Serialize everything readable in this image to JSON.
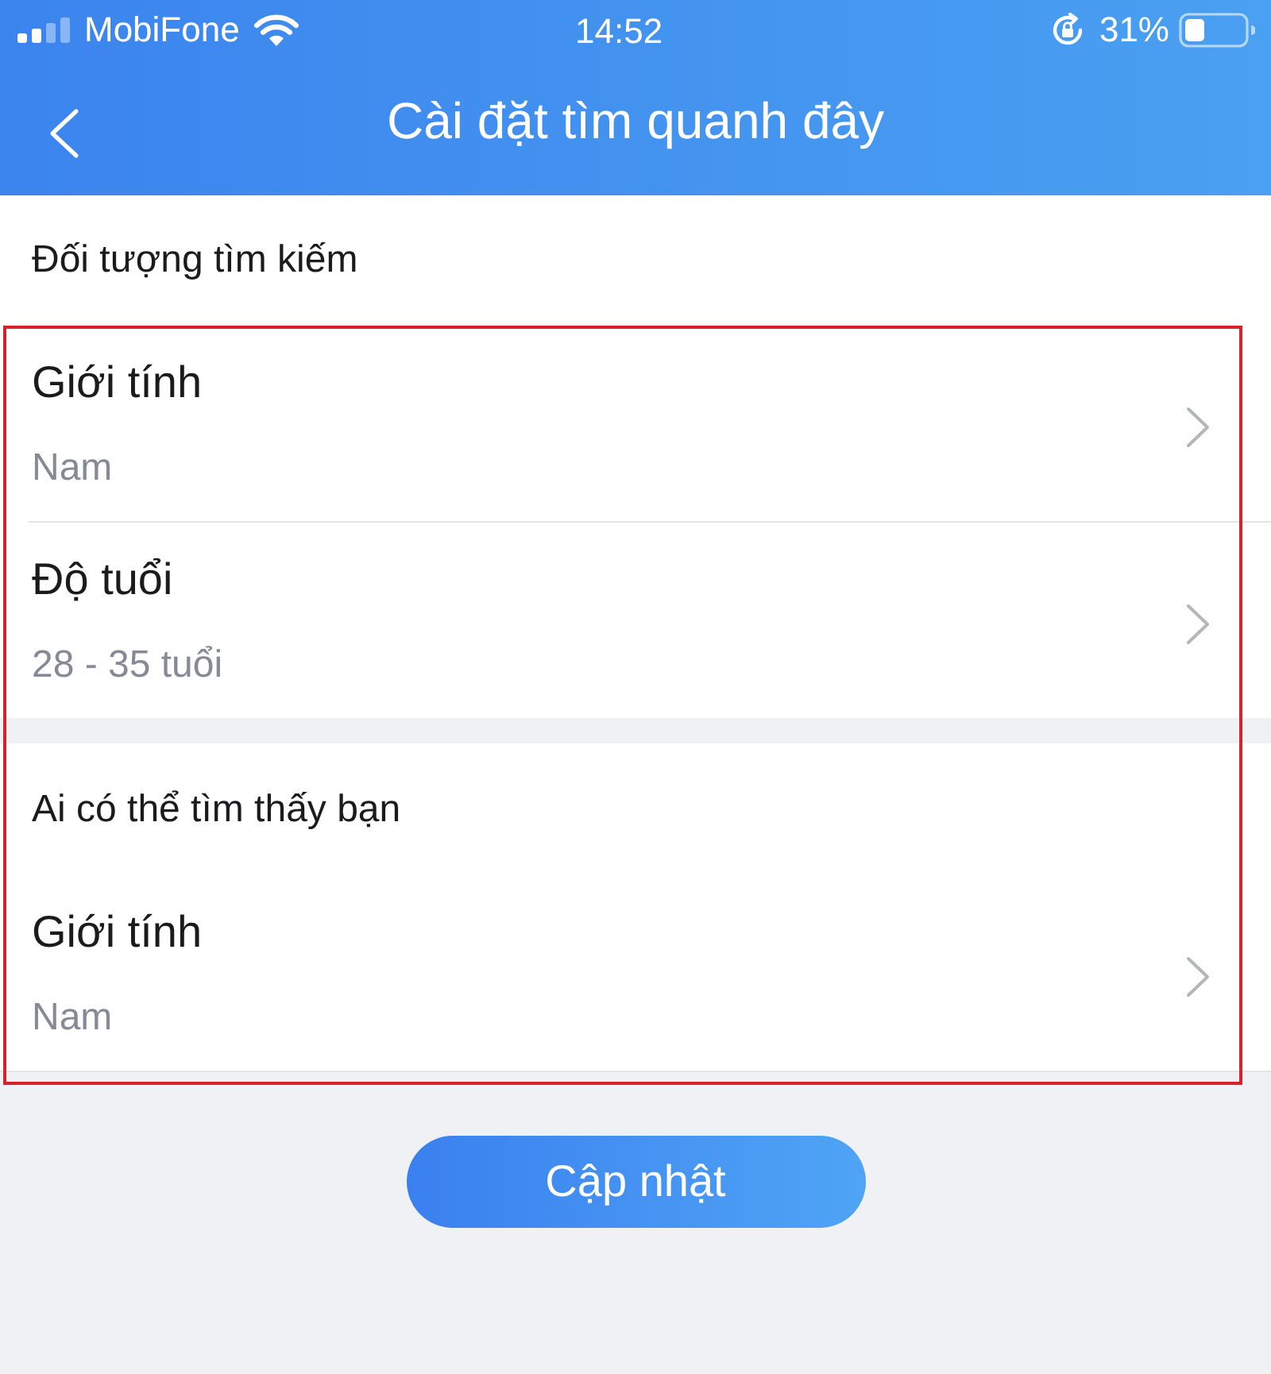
{
  "status_bar": {
    "carrier": "MobiFone",
    "time": "14:52",
    "battery": "31%"
  },
  "nav_bar": {
    "title": "Cài đặt tìm quanh đây"
  },
  "sections": [
    {
      "header": "Đối tượng tìm kiếm",
      "items": [
        {
          "label": "Giới tính",
          "value": "Nam"
        },
        {
          "label": "Độ tuổi",
          "value": "28 - 35 tuổi"
        }
      ]
    },
    {
      "header": "Ai có thể tìm thấy bạn",
      "items": [
        {
          "label": "Giới tính",
          "value": "Nam"
        }
      ]
    }
  ],
  "update_button": {
    "label": "Cập nhật"
  }
}
